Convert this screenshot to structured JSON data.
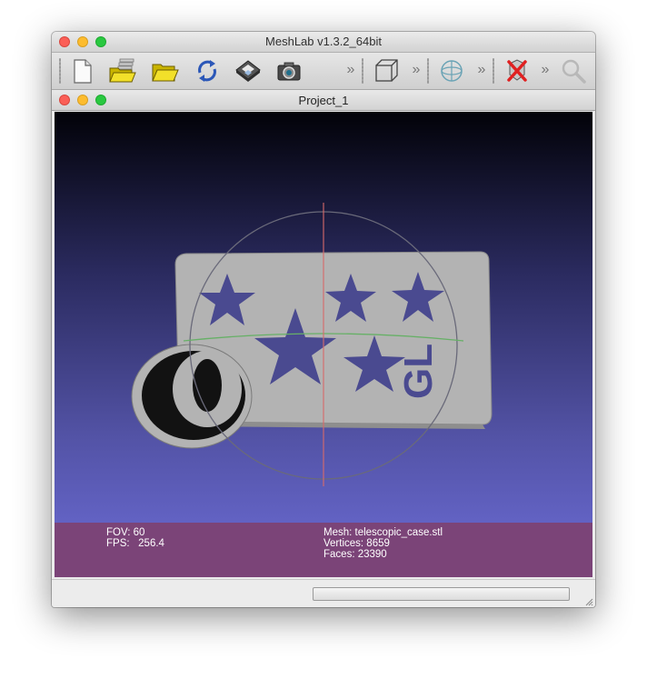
{
  "window": {
    "title": "MeshLab v1.3.2_64bit"
  },
  "toolbar": {
    "items": [
      "new-document-icon",
      "open-layers-icon",
      "open-folder-icon",
      "reload-icon",
      "save-icon",
      "snapshot-icon",
      "cube-view-icon",
      "trackball-icon",
      "delete-icon",
      "zoom-icon"
    ],
    "overflow_glyph": "»"
  },
  "project": {
    "title": "Project_1"
  },
  "viewport": {
    "fov_label": "FOV: 60",
    "fps_label": "FPS:",
    "fps_value": "256.4",
    "mesh_label": "Mesh: telescopic_case.stl",
    "vertices_label": "Vertices: 8659",
    "faces_label": "Faces: 23390",
    "model_text": "GL"
  },
  "colors": {
    "info_bar": "#7b4478",
    "mesh_fill": "#b3b3b3",
    "star_fill": "#4a4a90",
    "trackball": "#6a6a7a"
  },
  "statusbar": {
    "progress": 0
  }
}
